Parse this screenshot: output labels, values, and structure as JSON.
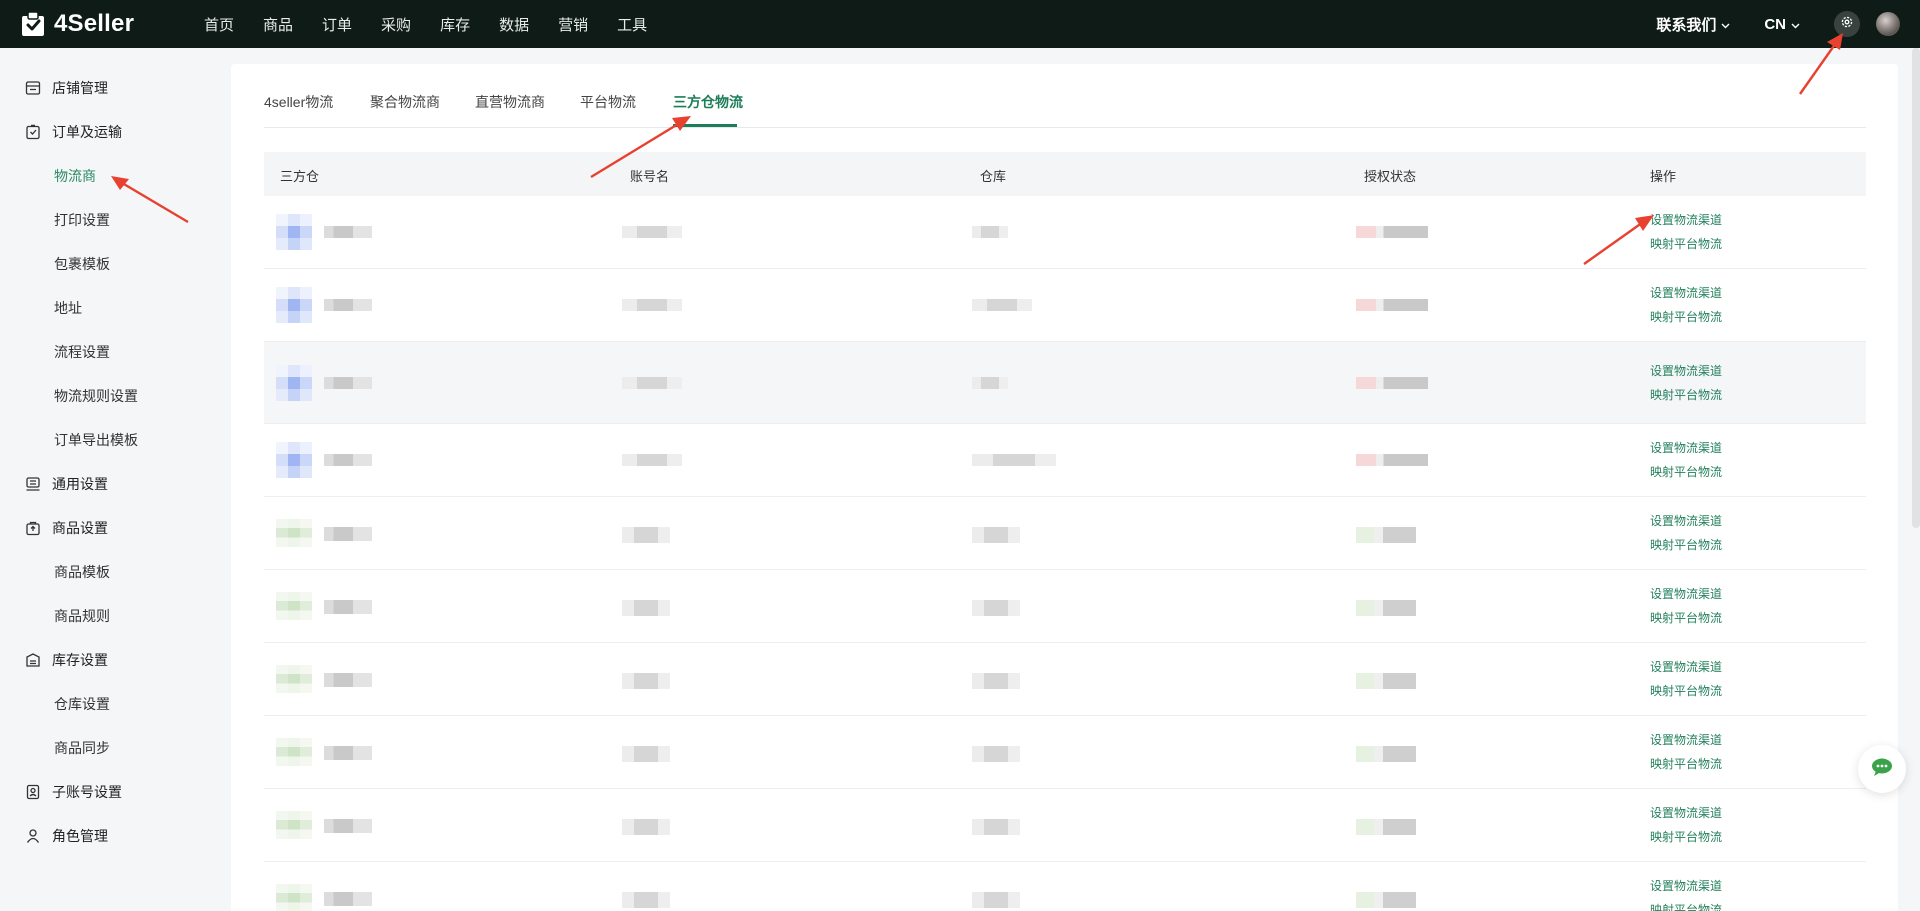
{
  "app": {
    "name": "4Seller"
  },
  "topnav": {
    "items": [
      "首页",
      "商品",
      "订单",
      "采购",
      "库存",
      "数据",
      "营销",
      "工具"
    ],
    "contact_label": "联系我们",
    "lang_label": "CN"
  },
  "sidebar": {
    "items": [
      {
        "label": "店铺管理",
        "icon": "store-icon"
      },
      {
        "label": "订单及运输",
        "icon": "clipboard-icon"
      },
      {
        "label": "物流商",
        "sub": true,
        "active": true
      },
      {
        "label": "打印设置",
        "sub": true
      },
      {
        "label": "包裹模板",
        "sub": true
      },
      {
        "label": "地址",
        "sub": true
      },
      {
        "label": "流程设置",
        "sub": true
      },
      {
        "label": "物流规则设置",
        "sub": true
      },
      {
        "label": "订单导出模板",
        "sub": true
      },
      {
        "label": "通用设置",
        "icon": "monitor-icon"
      },
      {
        "label": "商品设置",
        "icon": "bag-icon"
      },
      {
        "label": "商品模板",
        "sub": true
      },
      {
        "label": "商品规则",
        "sub": true
      },
      {
        "label": "库存设置",
        "icon": "warehouse-icon"
      },
      {
        "label": "仓库设置",
        "sub": true
      },
      {
        "label": "商品同步",
        "sub": true
      },
      {
        "label": "子账号设置",
        "icon": "badge-icon"
      },
      {
        "label": "角色管理",
        "icon": "user-icon"
      }
    ]
  },
  "tabs": [
    {
      "label": "4seller物流"
    },
    {
      "label": "聚合物流商"
    },
    {
      "label": "直营物流商"
    },
    {
      "label": "平台物流"
    },
    {
      "label": "三方仓物流",
      "active": true
    }
  ],
  "table": {
    "columns": [
      "三方仓",
      "账号名",
      "仓库",
      "授权状态",
      "操作"
    ],
    "row_count": 10,
    "actions": {
      "set_channel": "设置物流渠道",
      "map_platform": "映射平台物流"
    }
  },
  "colors": {
    "topbar_bg": "#0e1b16",
    "accent_green": "#1d7d59",
    "link_green": "#24805d",
    "annotation_red": "#e8412f"
  }
}
